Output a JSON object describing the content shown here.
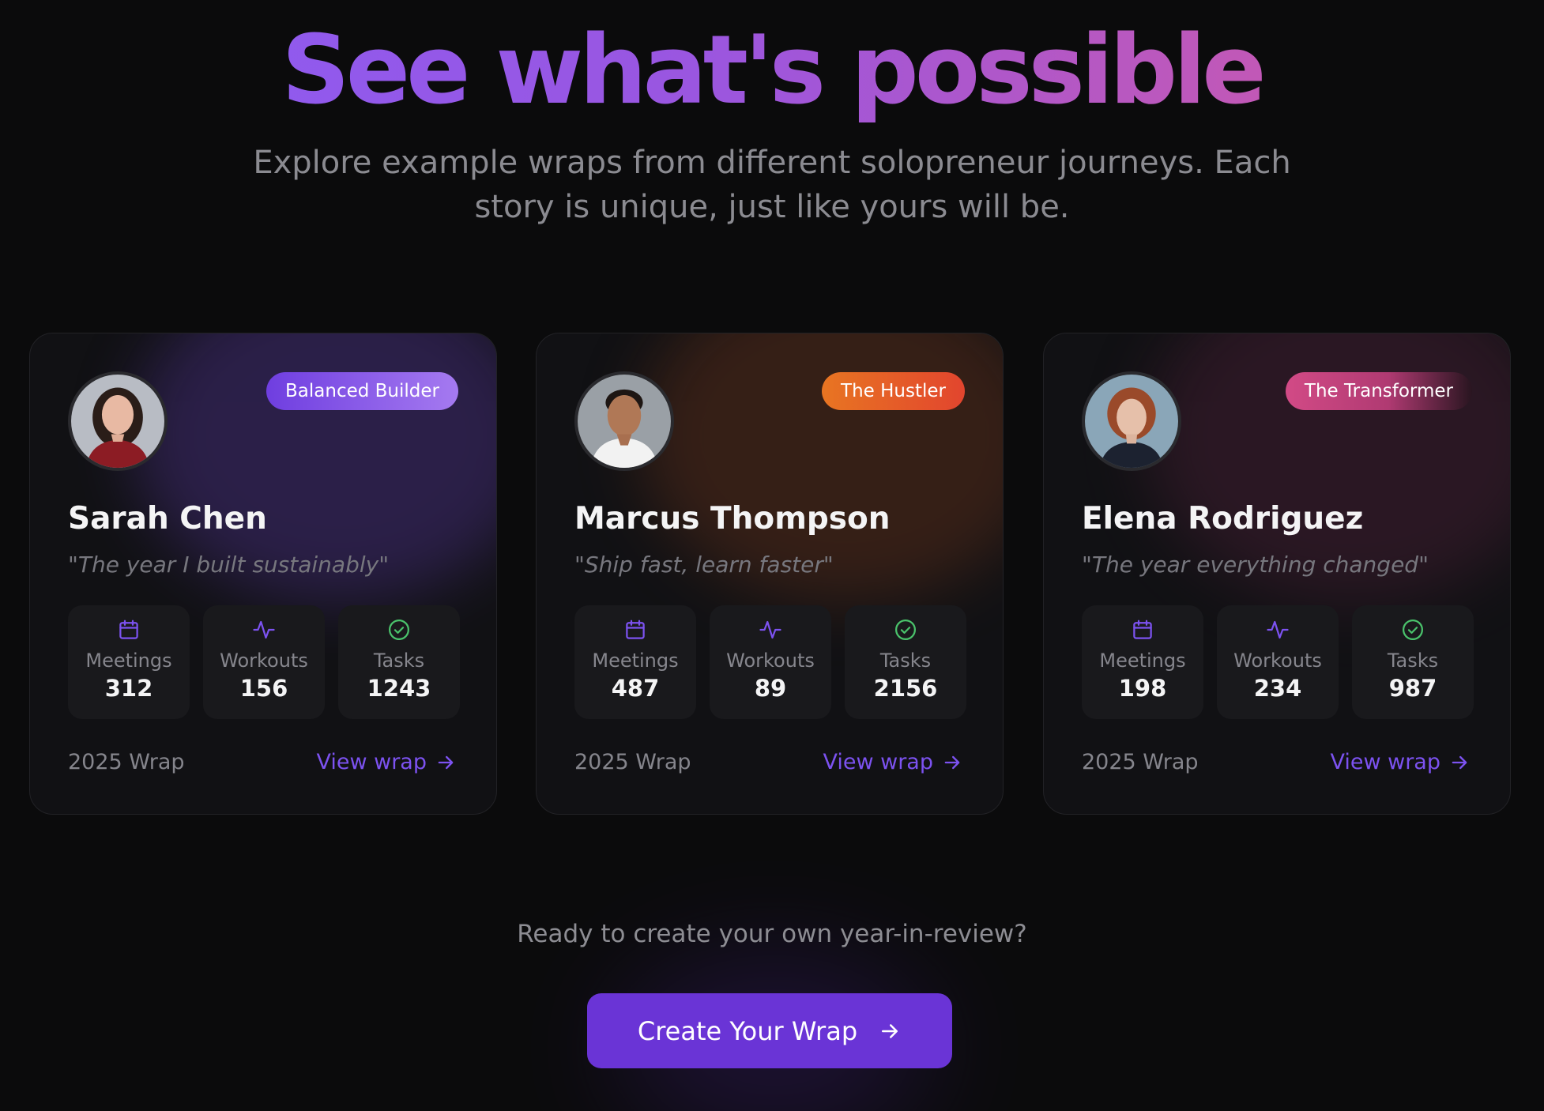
{
  "hero": {
    "title": "See what's possible",
    "subtitle": "Explore example wraps from different solopreneur journeys. Each story is unique, just like yours will be."
  },
  "colors": {
    "accent": "#6a34d6",
    "link": "#7c52f0",
    "background": "#0b0b0c",
    "card": "#111114",
    "check_green": "#4ac26b"
  },
  "stat_labels": {
    "meetings": "Meetings",
    "workouts": "Workouts",
    "tasks": "Tasks"
  },
  "cards": [
    {
      "name": "Sarah Chen",
      "badge": "Balanced Builder",
      "quote": "\"The year I built sustainably\"",
      "meetings": "312",
      "workouts": "156",
      "tasks": "1243",
      "footer": "2025 Wrap",
      "link": "View wrap",
      "avatar_icon": "avatar-photo-icon"
    },
    {
      "name": "Marcus Thompson",
      "badge": "The Hustler",
      "quote": "\"Ship fast, learn faster\"",
      "meetings": "487",
      "workouts": "89",
      "tasks": "2156",
      "footer": "2025 Wrap",
      "link": "View wrap",
      "avatar_icon": "avatar-photo-icon"
    },
    {
      "name": "Elena Rodriguez",
      "badge": "The Transformer",
      "quote": "\"The year everything changed\"",
      "meetings": "198",
      "workouts": "234",
      "tasks": "987",
      "footer": "2025 Wrap",
      "link": "View wrap",
      "avatar_icon": "avatar-photo-icon"
    }
  ],
  "cta": {
    "prompt": "Ready to create your own year-in-review?",
    "button": "Create Your Wrap"
  }
}
